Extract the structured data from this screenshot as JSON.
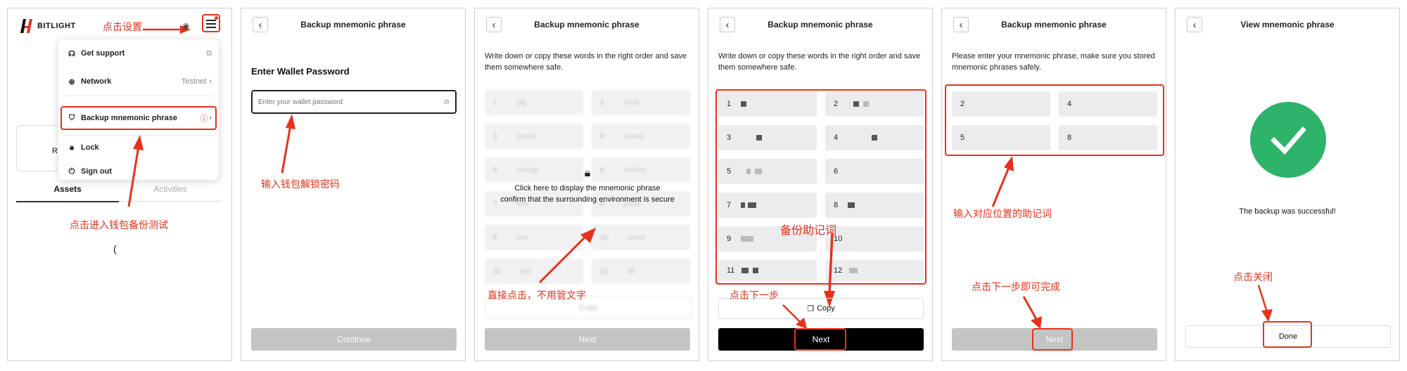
{
  "panel1": {
    "logo_text": "BITLIGHT",
    "menu": {
      "get_support": "Get support",
      "network_label": "Network",
      "network_value": "Testnet",
      "backup": "Backup mnemonic phrase",
      "lock": "Lock",
      "sign_out": "Sign out"
    },
    "card_partial": "R",
    "tab_assets": "Assets",
    "tab_activities": "Activities",
    "loading": "(",
    "ann_settings": "点击设置",
    "ann_backup": "点击进入钱包备份测试"
  },
  "panel2": {
    "title": "Backup mnemonic phrase",
    "heading": "Enter Wallet Password",
    "password_placeholder": "Enter your wallet password",
    "continue": "Continue",
    "ann": "输入钱包解锁密码"
  },
  "panel3": {
    "title": "Backup mnemonic phrase",
    "desc": "Write down or copy these words in the right order and save them somewhere safe.",
    "reveal_line1": "Click here to display the mnemonic phrase",
    "reveal_line2": "confirm that the surrounding environment is secure",
    "blurred_words": [
      {
        "n": "1",
        "w": "pig"
      },
      {
        "n": "2",
        "w": "smile"
      },
      {
        "n": "3",
        "w": "bench"
      },
      {
        "n": "4",
        "w": "review"
      },
      {
        "n": "5",
        "w": "orange"
      },
      {
        "n": "6",
        "w": "fashion"
      },
      {
        "n": "7",
        "w": "tree"
      },
      {
        "n": "8",
        "w": "panic"
      },
      {
        "n": "9",
        "w": "true"
      },
      {
        "n": "10",
        "w": "amen"
      },
      {
        "n": "11",
        "w": "sail"
      },
      {
        "n": "12",
        "w": "all"
      }
    ],
    "copy": "Copy",
    "next": "Next",
    "ann": "直接点击，不用管文字"
  },
  "panel4": {
    "title": "Backup mnemonic phrase",
    "desc": "Write down or copy these words in the right order and save them somewhere safe.",
    "numbers": [
      "1",
      "2",
      "3",
      "4",
      "5",
      "6",
      "7",
      "8",
      "9",
      "10",
      "11",
      "12"
    ],
    "copy": "Copy",
    "next": "Next",
    "ann_backup": "备份助记词",
    "ann_next": "点击下一步"
  },
  "panel5": {
    "title": "Backup mnemonic phrase",
    "desc": "Please enter your mnemonic phrase, make sure you stored mnemonic phrases safely.",
    "fields": [
      "2",
      "4",
      "5",
      "8"
    ],
    "next": "Next",
    "ann_enter": "输入对应位置的助记词",
    "ann_next": "点击下一步即可完成"
  },
  "panel6": {
    "title": "View mnemonic phrase",
    "success": "The backup was successful!",
    "done": "Done",
    "ann": "点击关闭"
  },
  "colors": {
    "accent_red": "#e8311a",
    "success_green": "#2db36a"
  }
}
